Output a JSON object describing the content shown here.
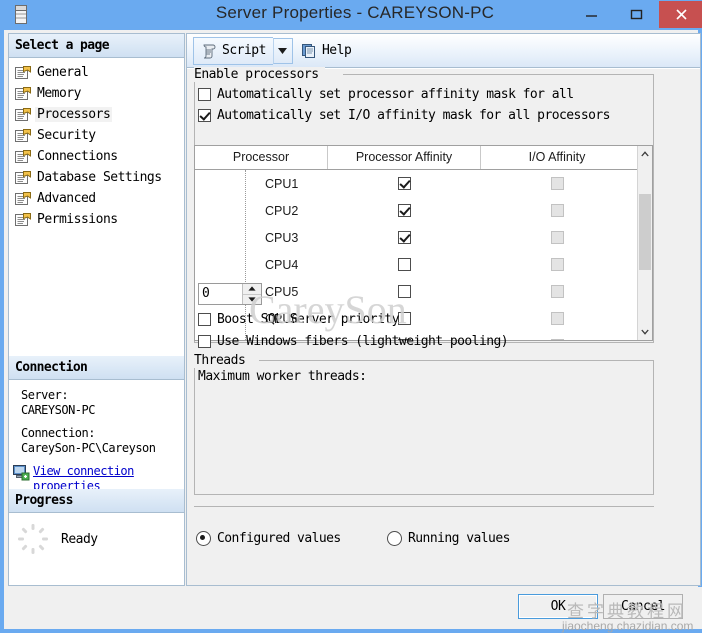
{
  "window": {
    "title": "Server Properties - CAREYSON-PC",
    "icon": "server-icon",
    "minimize_label": "Minimize",
    "maximize_label": "Maximize",
    "close_label": "Close",
    "titlebar_color": "#6aaaf0",
    "close_button_color": "#c75050"
  },
  "sidebar": {
    "header": "Select a page",
    "items": [
      {
        "label": "General",
        "selected": false
      },
      {
        "label": "Memory",
        "selected": false
      },
      {
        "label": "Processors",
        "selected": true
      },
      {
        "label": "Security",
        "selected": false
      },
      {
        "label": "Connections",
        "selected": false
      },
      {
        "label": "Database Settings",
        "selected": false
      },
      {
        "label": "Advanced",
        "selected": false
      },
      {
        "label": "Permissions",
        "selected": false
      }
    ],
    "connection": {
      "header": "Connection",
      "server_label": "Server:",
      "server_value": "CAREYSON-PC",
      "connection_label": "Connection:",
      "connection_value": "CareySon-PC\\Careyson",
      "link": "View connection properties"
    },
    "progress": {
      "header": "Progress",
      "status": "Ready"
    }
  },
  "toolbar": {
    "script_label": "Script",
    "script_dropdown": "▼",
    "help_label": "Help"
  },
  "enable_processors": {
    "group_label": "Enable processors",
    "auto_processor_affinity": {
      "label": "Automatically set processor affinity mask for all",
      "checked": false
    },
    "auto_io_affinity": {
      "label": "Automatically set I/O affinity mask for all processors",
      "checked": true
    },
    "table": {
      "columns": [
        "Processor",
        "Processor Affinity",
        "I/O Affinity"
      ],
      "rows": [
        {
          "name": "CPU1",
          "processor_affinity": true,
          "io_affinity": false,
          "io_disabled": true
        },
        {
          "name": "CPU2",
          "processor_affinity": true,
          "io_affinity": false,
          "io_disabled": true
        },
        {
          "name": "CPU3",
          "processor_affinity": true,
          "io_affinity": false,
          "io_disabled": true
        },
        {
          "name": "CPU4",
          "processor_affinity": false,
          "io_affinity": false,
          "io_disabled": true
        },
        {
          "name": "CPU5",
          "processor_affinity": false,
          "io_affinity": false,
          "io_disabled": true
        },
        {
          "name": "CPU6",
          "processor_affinity": false,
          "io_affinity": false,
          "io_disabled": true
        },
        {
          "name": "",
          "processor_affinity": false,
          "io_affinity": false,
          "io_disabled": true
        }
      ]
    }
  },
  "threads": {
    "group_label": "Threads",
    "max_worker_threads_label": "Maximum worker threads:",
    "max_worker_threads_value": "0",
    "boost_priority": {
      "label": "Boost SQL Server priority",
      "checked": false
    },
    "use_fibers": {
      "label": "Use Windows fibers (lightweight pooling)",
      "checked": false
    }
  },
  "values_mode": {
    "configured": {
      "label": "Configured  values",
      "selected": true
    },
    "running": {
      "label": "Running values",
      "selected": false
    }
  },
  "footer": {
    "ok_label": "OK",
    "cancel_label": "Cancel"
  },
  "watermarks": {
    "center": "CareySon",
    "cn_text": "查字典教程网",
    "url": "jiaocheng.chazidian.com"
  }
}
